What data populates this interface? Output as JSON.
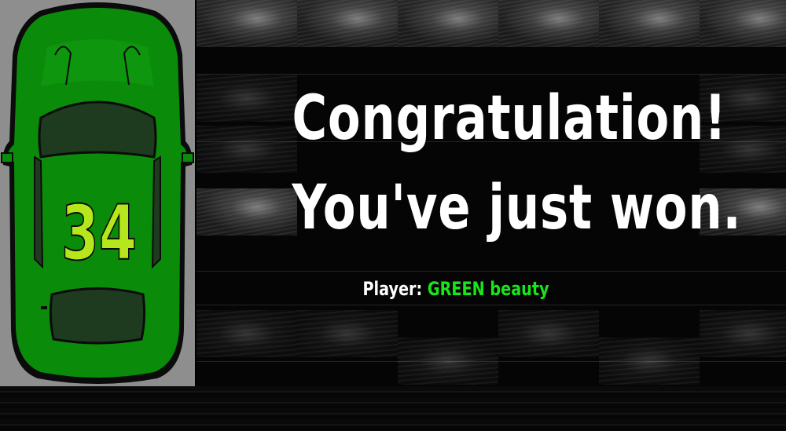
{
  "headline": {
    "line1": "Congratulation!",
    "line2": "You've just won."
  },
  "player": {
    "label": "Player:",
    "name_main": "GREEN",
    "name_rest": "beauty"
  },
  "car": {
    "number": "34",
    "body_color": "#0a8c0a",
    "number_color": "#b6e61c"
  },
  "colors": {
    "background": "#000000",
    "road": "#8e8e8e",
    "text": "#ffffff",
    "player_name": "#19e619"
  }
}
